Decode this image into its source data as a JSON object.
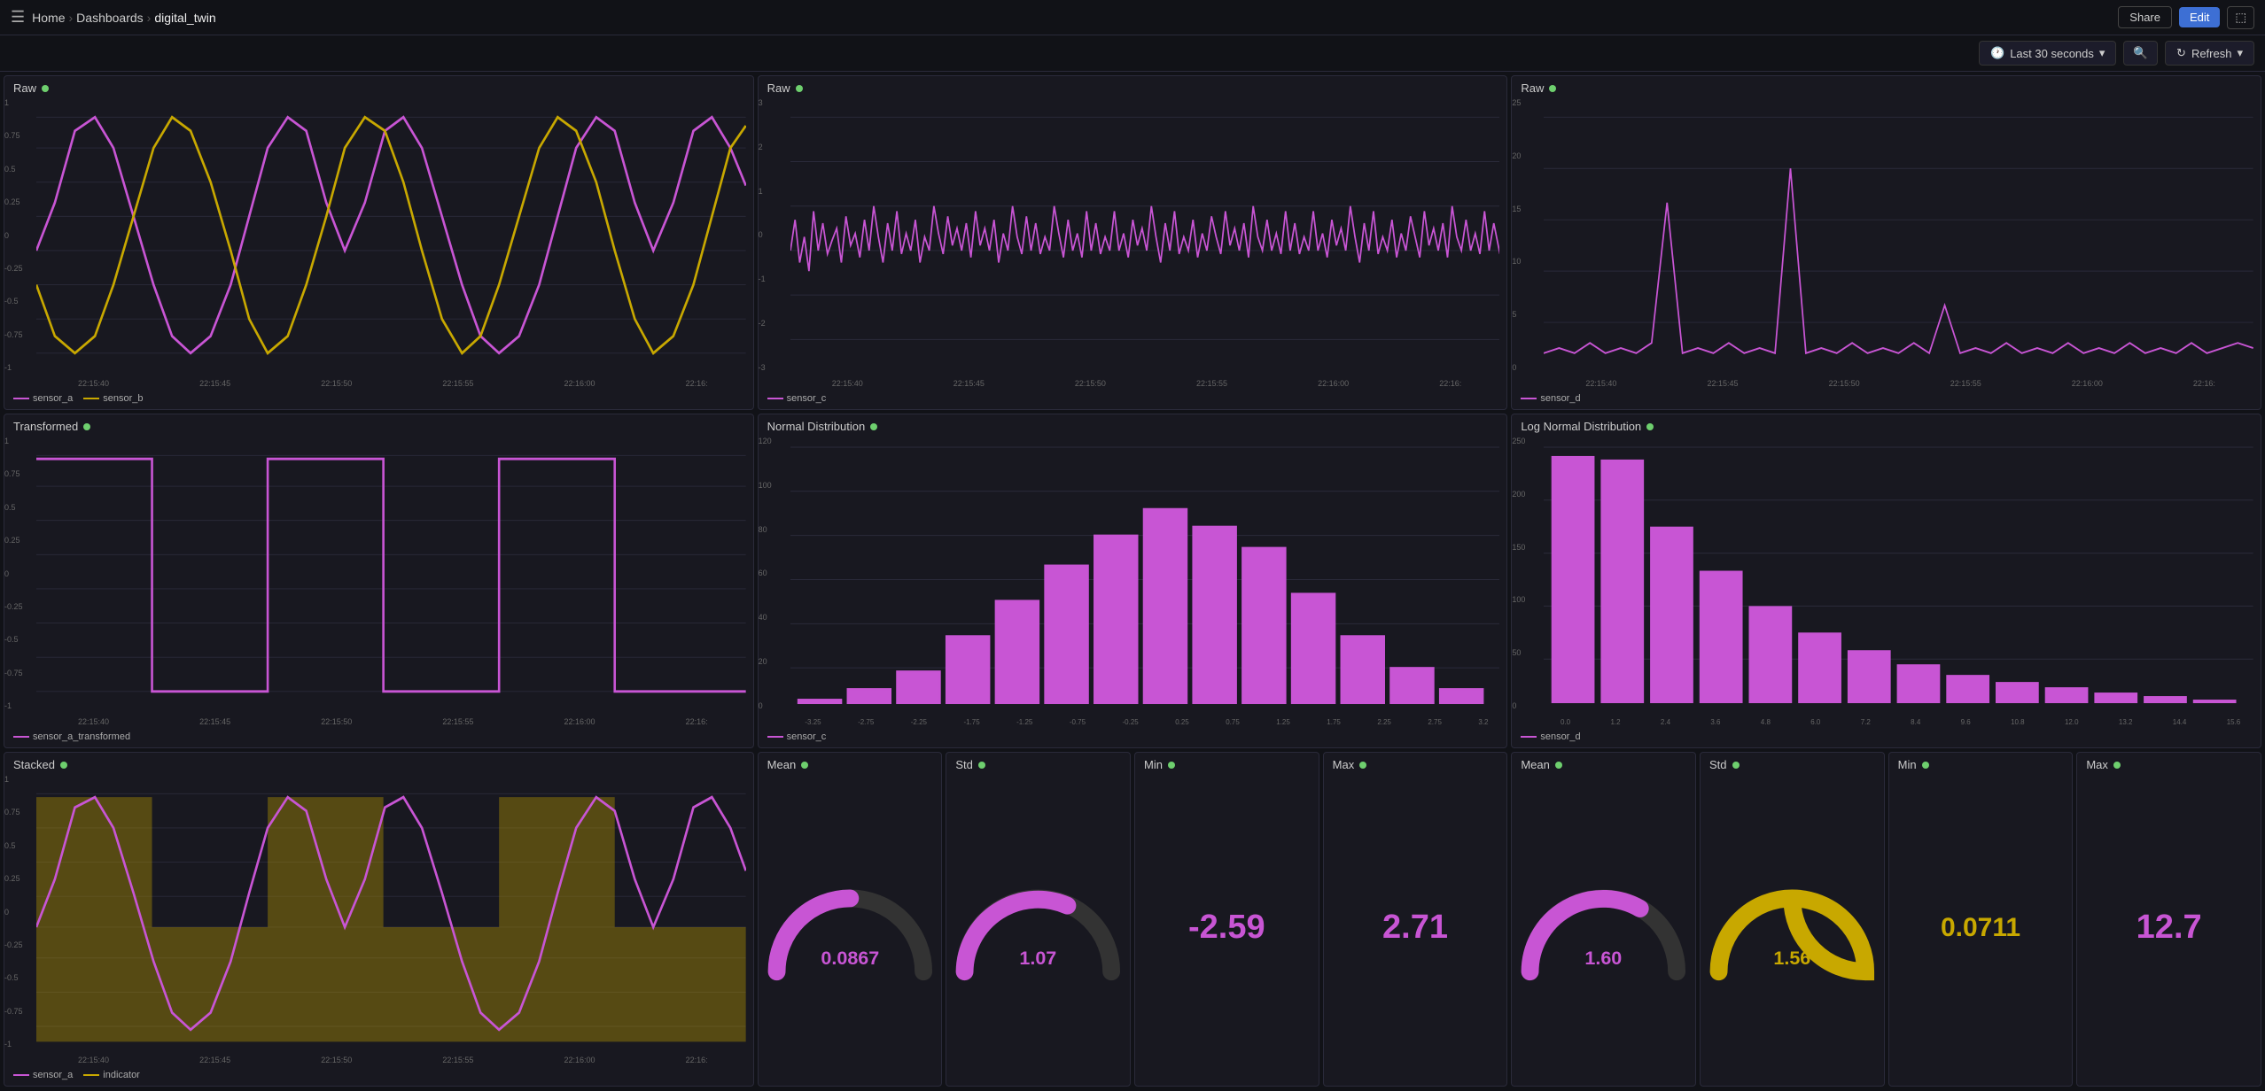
{
  "topbar": {
    "home_label": "Home",
    "dashboards_label": "Dashboards",
    "current_label": "digital_twin",
    "share_label": "Share",
    "edit_label": "Edit"
  },
  "toolbar": {
    "time_range_label": "Last 30 seconds",
    "refresh_label": "Refresh"
  },
  "panels": {
    "row1": [
      {
        "title": "Raw",
        "sensors": [
          "sensor_a",
          "sensor_b"
        ],
        "colors": [
          "#c855d4",
          "#c8a800"
        ],
        "y_labels": [
          "1",
          "0.75",
          "0.5",
          "0.25",
          "0",
          "-0.25",
          "-0.5",
          "-0.75",
          "-1"
        ],
        "x_labels": [
          "22:15:40",
          "22:15:45",
          "22:15:50",
          "22:15:55",
          "22:16:00",
          "22:16:"
        ]
      },
      {
        "title": "Raw",
        "sensors": [
          "sensor_c"
        ],
        "colors": [
          "#c855d4"
        ],
        "y_labels": [
          "3",
          "2",
          "1",
          "0",
          "-1",
          "-2",
          "-3"
        ],
        "x_labels": [
          "22:15:40",
          "22:15:45",
          "22:15:50",
          "22:15:55",
          "22:16:00",
          "22:16:"
        ]
      },
      {
        "title": "Raw",
        "sensors": [
          "sensor_d"
        ],
        "colors": [
          "#c855d4"
        ],
        "y_labels": [
          "25",
          "20",
          "15",
          "10",
          "5",
          "0"
        ],
        "x_labels": [
          "22:15:40",
          "22:15:45",
          "22:15:50",
          "22:15:55",
          "22:16:00",
          "22:16:"
        ]
      }
    ],
    "row2": [
      {
        "title": "Transformed",
        "sensors": [
          "sensor_a_transformed"
        ],
        "colors": [
          "#c855d4"
        ],
        "y_labels": [
          "1",
          "0.75",
          "0.5",
          "0.25",
          "0",
          "-0.25",
          "-0.5",
          "-0.75",
          "-1"
        ],
        "x_labels": [
          "22:15:40",
          "22:15:45",
          "22:15:50",
          "22:15:55",
          "22:16:00",
          "22:16:"
        ]
      },
      {
        "title": "Normal Distribution",
        "sensors": [
          "sensor_c"
        ],
        "colors": [
          "#c855d4"
        ],
        "y_labels": [
          "120",
          "100",
          "80",
          "60",
          "40",
          "20",
          "0"
        ],
        "x_labels": [
          "-3.25",
          "-2.75",
          "-2.25",
          "-1.75",
          "-1.25",
          "-0.75",
          "-0.25",
          "0.25",
          "0.75",
          "1.25",
          "1.75",
          "2.25",
          "2.75",
          "3.2"
        ]
      },
      {
        "title": "Log Normal Distribution",
        "sensors": [
          "sensor_d"
        ],
        "colors": [
          "#c855d4"
        ],
        "y_labels": [
          "250",
          "200",
          "150",
          "100",
          "50",
          "0"
        ],
        "x_labels": [
          "0.0",
          "1.2",
          "2.4",
          "3.6",
          "4.8",
          "6.0",
          "7.2",
          "8.4",
          "9.6",
          "10.8",
          "12.0",
          "13.2",
          "14.4",
          "15.6"
        ]
      }
    ],
    "row3_left": {
      "title": "Stacked",
      "sensors": [
        "sensor_a",
        "indicator"
      ],
      "colors": [
        "#c855d4",
        "#c8a800"
      ],
      "y_labels": [
        "1",
        "0.75",
        "0.5",
        "0.25",
        "0",
        "-0.25",
        "-0.5",
        "-0.75",
        "-1"
      ],
      "x_labels": [
        "22:15:40",
        "22:15:45",
        "22:15:50",
        "22:15:55",
        "22:16:00",
        "22:16:"
      ]
    },
    "gauges_left": [
      {
        "title": "Mean",
        "type": "gauge",
        "value": "0.0867",
        "color_arc": "#c855d4",
        "color_bg": "#333"
      },
      {
        "title": "Std",
        "type": "gauge",
        "value": "1.07",
        "color_arc": "#c855d4",
        "color_bg": "#333"
      },
      {
        "title": "Min",
        "type": "stat",
        "value": "-2.59",
        "color": "#c855d4"
      },
      {
        "title": "Max",
        "type": "stat",
        "value": "2.71",
        "color": "#c855d4"
      }
    ],
    "gauges_right": [
      {
        "title": "Mean",
        "type": "gauge",
        "value": "1.60",
        "color_arc": "#c855d4",
        "color_bg": "#333"
      },
      {
        "title": "Std",
        "type": "gauge",
        "value": "1.56",
        "color_arc": "#c8a800",
        "color_bg": "#333"
      },
      {
        "title": "Min",
        "type": "stat",
        "value": "0.0711",
        "color": "#c8a800"
      },
      {
        "title": "Max",
        "type": "stat",
        "value": "12.7",
        "color": "#c855d4"
      }
    ]
  }
}
